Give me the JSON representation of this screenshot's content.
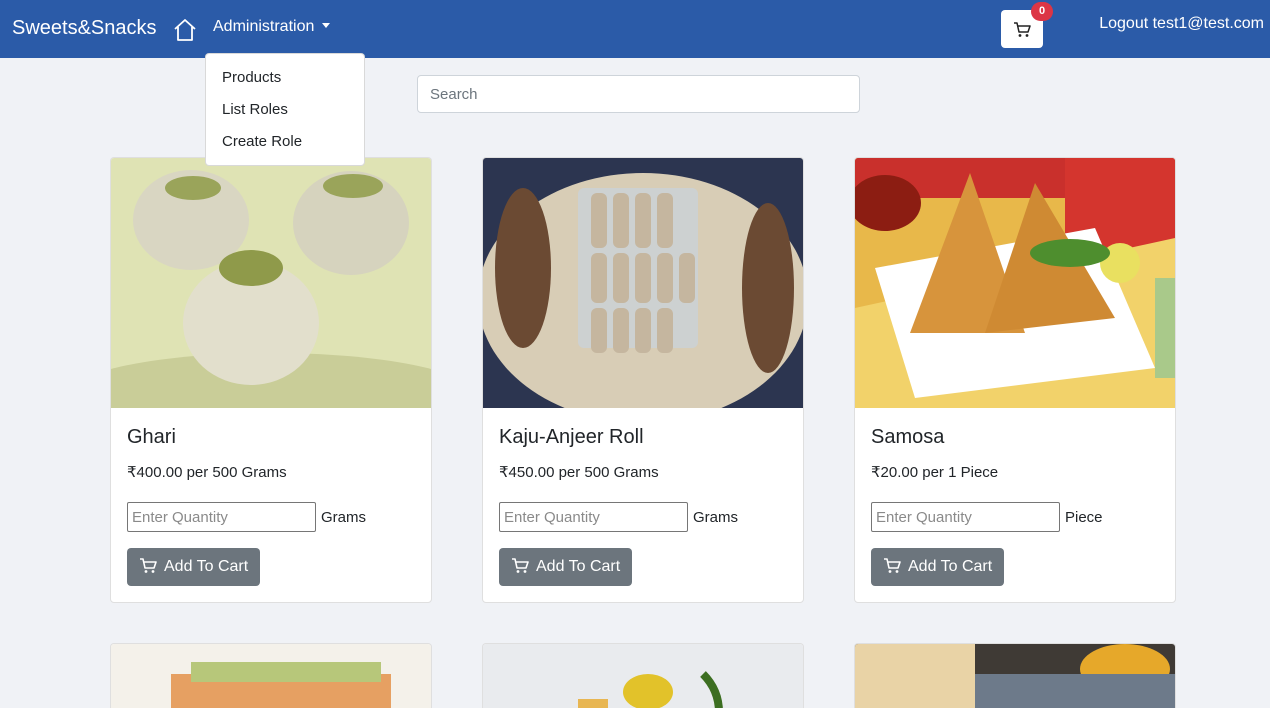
{
  "navbar": {
    "brand": "Sweets&Snacks",
    "admin_label": "Administration",
    "cart_count": "0",
    "logout_label": "Logout test1@test.com"
  },
  "dropdown": {
    "items": [
      {
        "label": "Products"
      },
      {
        "label": "List Roles"
      },
      {
        "label": "Create Role"
      }
    ]
  },
  "search": {
    "placeholder": "Search"
  },
  "products": [
    {
      "name": "Ghari",
      "price": "₹400.00 per 500 Grams",
      "placeholder": "Enter Quantity",
      "unit": "Grams",
      "button": "Add To Cart"
    },
    {
      "name": "Kaju-Anjeer Roll",
      "price": "₹450.00 per 500 Grams",
      "placeholder": "Enter Quantity",
      "unit": "Grams",
      "button": "Add To Cart"
    },
    {
      "name": "Samosa",
      "price": "₹20.00 per 1 Piece",
      "placeholder": "Enter Quantity",
      "unit": "Piece",
      "button": "Add To Cart"
    }
  ],
  "colors": {
    "navbar": "#2b5ba8",
    "badge": "#dc3545",
    "button": "#6c757d",
    "background": "#f0f2f6"
  }
}
